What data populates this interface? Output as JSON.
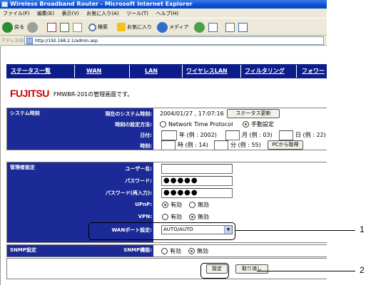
{
  "window": {
    "title": "Wireless Broadband Router - Microsoft Internet Explorer",
    "menu": [
      "ファイル(F)",
      "編集(E)",
      "表示(V)",
      "お気に入り(A)",
      "ツール(T)",
      "ヘルプ(H)"
    ],
    "toolbar": {
      "back": "戻る",
      "search": "検索",
      "favorites": "お気に入り",
      "media": "メディア"
    },
    "address_label": "アドレス(D)",
    "address": "http://192.168.2.1/admin.asp"
  },
  "nav": [
    "ステータス一覧",
    "WAN",
    "LAN",
    "ワイヤレスLAN",
    "フィルタリング",
    "フォワー"
  ],
  "brand": {
    "logo": "FUJITSU",
    "text": "FMWBR-201の管理画面です。"
  },
  "system_time": {
    "title": "システム時刻",
    "current_label": "現在のシステム時刻:",
    "current_value": "2004/01/27 , 17:07:16",
    "refresh_button": "ステータス更新",
    "method_label": "時刻の設定方法:",
    "method_ntp": "Network Time Protocol",
    "method_manual": "手動設定",
    "method_selected": "manual",
    "date_label": "日付:",
    "year_hint": "年 (例 : 2002)",
    "month_hint": "月 (例 : 03)",
    "day_hint": "日 (例 : 22)",
    "time_label": "時刻:",
    "hour_hint": "時 (例 : 14)",
    "minute_hint": "分 (例 : 55)",
    "pc_button": "PCから取得"
  },
  "admin": {
    "title": "管理者設定",
    "user_label": "ユーザー名:",
    "user_value": "",
    "password_label": "パスワード:",
    "password_value": "●●●●●",
    "password_confirm_label": "パスワード(再入力):",
    "password_confirm_value": "●●●●●",
    "upnp_label": "UPnP:",
    "upnp_selected": "on",
    "vpn_label": "VPN:",
    "vpn_selected": "off",
    "wan_port_label": "WANポート設定:",
    "wan_port_value": "AUTO/AUTO",
    "on_label": "有効",
    "off_label": "無効"
  },
  "snmp": {
    "title": "SNMP設定",
    "label": "SNMP機能:",
    "selected": "off",
    "on_label": "有効",
    "off_label": "無効"
  },
  "actions": {
    "apply": "設定",
    "cancel": "取り消し"
  },
  "callouts": [
    "1",
    "2"
  ]
}
